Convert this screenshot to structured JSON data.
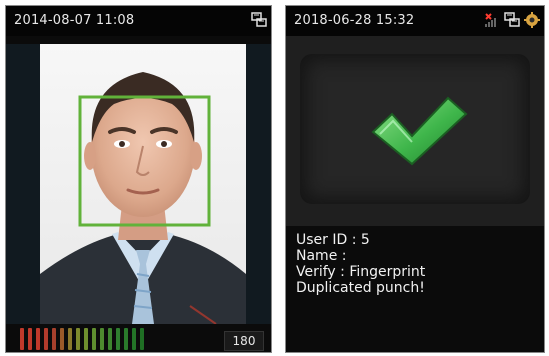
{
  "left_screen": {
    "datetime": "2014-08-07 11:08",
    "icons": [
      "network-icon"
    ],
    "meter": {
      "value": "180",
      "level_fraction": 1.0,
      "bar_colors": [
        "#c0392b",
        "#c0392b",
        "#c0392b",
        "#b23b2c",
        "#a7402c",
        "#9a5a2a",
        "#8b7a2c",
        "#7e8b2d",
        "#6f8f2e",
        "#5f8f2f",
        "#4e8a2f",
        "#3e852f",
        "#2f7f2f",
        "#2a7a2b",
        "#237427",
        "#1f6f24"
      ]
    }
  },
  "right_screen": {
    "datetime": "2018-06-28 15:32",
    "icons": [
      "no-signal-icon",
      "network-icon",
      "settings-icon"
    ],
    "info": {
      "user_id": "User ID : 5",
      "name": "Name :",
      "verify": "Verify : Fingerprint",
      "status": "Duplicated punch!"
    }
  }
}
